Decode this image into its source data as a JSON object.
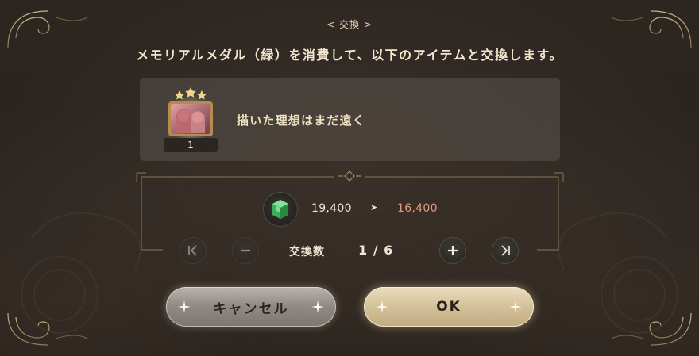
{
  "dialog": {
    "title": "< 交換 >",
    "message": "メモリアルメダル（緑）を消費して、以下のアイテムと交換します。"
  },
  "item": {
    "name": "描いた理想はまだ遠く",
    "count": "1",
    "thumbnail_icon": "memory-card-thumbnail"
  },
  "exchange": {
    "currency_icon": "green-gem-icon",
    "current": "19,400",
    "arrow": "➤",
    "after": "16,400",
    "after_color": "#e69882"
  },
  "quantity": {
    "label": "交換数",
    "value": "1 / 6"
  },
  "buttons": {
    "cancel": "キャンセル",
    "ok": "OK"
  },
  "colors": {
    "accent_gold": "#c7ad7c",
    "text_light": "#f0e1c0"
  }
}
